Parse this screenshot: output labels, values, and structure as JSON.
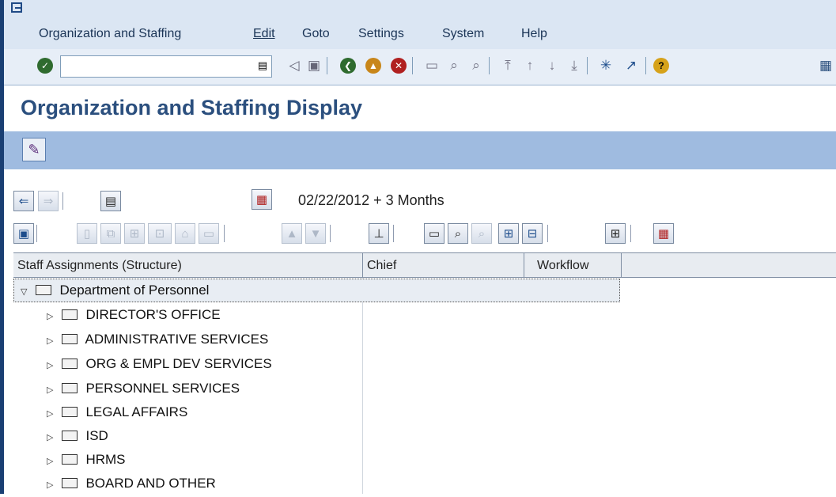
{
  "menu": {
    "items": [
      "Organization and Staffing",
      "Edit",
      "Goto",
      "Settings",
      "System",
      "Help"
    ]
  },
  "page": {
    "title": "Organization and Staffing Display",
    "date_range": "02/22/2012  + 3 Months"
  },
  "table": {
    "columns": [
      "Staff Assignments (Structure)",
      "Chief",
      "Workflow"
    ],
    "root": "Department of Personnel",
    "children": [
      "DIRECTOR'S OFFICE",
      "ADMINISTRATIVE SERVICES",
      "ORG & EMPL DEV SERVICES",
      "PERSONNEL SERVICES",
      "LEGAL AFFAIRS",
      "ISD",
      "HRMS",
      "BOARD AND OTHER"
    ]
  },
  "colors": {
    "title": "#2b4f7e",
    "app_toolbar": "#9fbbe0",
    "menu_bg": "#dbe6f3"
  }
}
